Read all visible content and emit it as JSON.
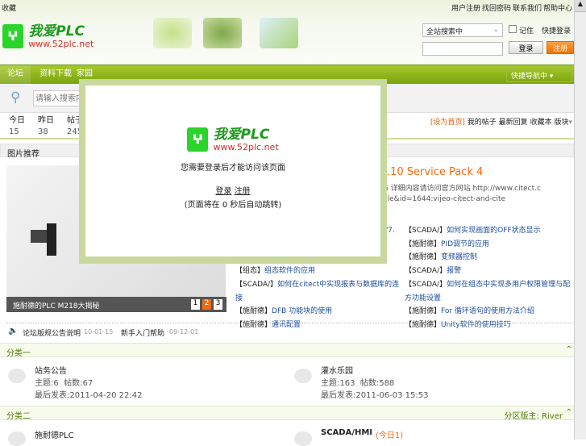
{
  "top": {
    "left_link": "收藏",
    "links": [
      "用户注册",
      "找回密码",
      "联系我们",
      "帮助中心"
    ]
  },
  "logo": {
    "name": "我爱PLC",
    "url": "www.52plc.net"
  },
  "login": {
    "select": "全站搜索中",
    "remember": "记住",
    "quick": "快捷登录",
    "login_btn": "登录",
    "register_btn": "注册",
    "username": ""
  },
  "nav": {
    "items": [
      "论坛",
      "资料下载",
      "家园"
    ],
    "quick_nav": "快捷导航中"
  },
  "search": {
    "placeholder": "请输入搜索内容"
  },
  "stats": [
    {
      "label": "今日",
      "value": "15"
    },
    {
      "label": "昨日",
      "value": "38"
    },
    {
      "label": "帖子数",
      "value": "245"
    }
  ],
  "links_right": [
    "[设为首页]",
    "我的帖子",
    "最新回复",
    "收藏本",
    "版块"
  ],
  "picture": {
    "title": "图片推荐",
    "caption": "施耐德的PLC M218大揭秘",
    "pages": [
      "1",
      "2",
      "3"
    ],
    "active": "2"
  },
  "headline": {
    "title": "DA V7.10 Service Pack 4",
    "desc1": "4已经发布 详细内容请访问官方网站 http://www.citect.c",
    "desc2": "ew=article&id=1644:vijeo-citect-and-cite"
  },
  "articles_left": [
    {
      "pre": "V7.",
      "link": ""
    },
    {
      "pre": "【组态】",
      "link": "组态软件的应用"
    },
    {
      "pre": "【SCADA/】",
      "link": "如何在citect中实现报表与数据库的连接"
    },
    {
      "pre": "【施耐德】",
      "link": "DFB 功能块的使用"
    },
    {
      "pre": "【施耐德】",
      "link": "通讯配置"
    }
  ],
  "articles_right": [
    {
      "pre": "【SCADA/】",
      "link": "如何实现画面的OFF状态显示"
    },
    {
      "pre": "【施耐德】",
      "link": "PID调节的应用"
    },
    {
      "pre": "【施耐德】",
      "link": "变频器控制"
    },
    {
      "pre": "【SCADA/】",
      "link": "报警"
    },
    {
      "pre": "【SCADA/】",
      "link": "如何在组态中实现多用户权限管理与配方功能设置"
    },
    {
      "pre": "【施耐德】",
      "link": "For 循环语句的使用方法介绍"
    },
    {
      "pre": "【施耐德】",
      "link": "Unity软件的使用技巧"
    }
  ],
  "announcements": [
    {
      "text": "论坛版规公告说明",
      "date": "10-01-15"
    },
    {
      "text": "新手入门帮助",
      "date": "09-12-01"
    }
  ],
  "category1": {
    "title": "分类一",
    "forums": [
      {
        "name": "站务公告",
        "topics_label": "主题",
        "topics": "6",
        "posts_label": "帖数",
        "posts": "67",
        "last_label": "最后发表",
        "last": "2011-04-20 22:42"
      },
      {
        "name": "灌水乐园",
        "topics_label": "主题",
        "topics": "163",
        "posts_label": "帖数",
        "posts": "588",
        "last_label": "最后发表",
        "last": "2011-06-03 15:53"
      }
    ]
  },
  "category2": {
    "title": "分类二",
    "mod_label": "分区版主:",
    "mod": "River",
    "forums": [
      {
        "name": "施耐德PLC"
      },
      {
        "name": "SCADA/HMI",
        "badge": "(今日1)"
      }
    ]
  },
  "modal": {
    "logo": "我爱PLC",
    "url": "www.52plc.net",
    "message": "您需要登录后才能访问该页面",
    "login": "登录",
    "register": "注册",
    "redirect": "(页面将在 0 秒后自动跳转)"
  }
}
